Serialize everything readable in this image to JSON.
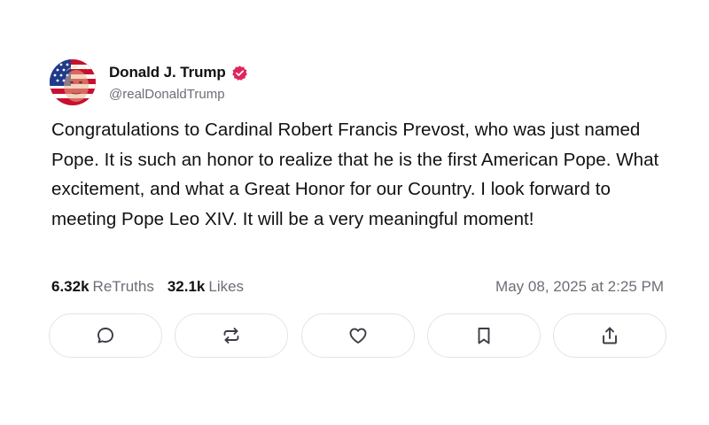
{
  "author": {
    "display_name": "Donald J. Trump",
    "handle": "@realDonaldTrump",
    "verified": true,
    "verified_color": "#e0245e"
  },
  "post": {
    "text": "Congratulations to Cardinal Robert Francis Prevost, who was just named Pope. It is such an honor to realize that he is the first American Pope. What excitement, and what a Great Honor for our Country. I look forward to meeting Pope Leo XIV. It will be a very meaningful moment!",
    "retruths_count": "6.32k",
    "retruths_label": "ReTruths",
    "likes_count": "32.1k",
    "likes_label": "Likes",
    "timestamp": "May 08, 2025 at 2:25 PM"
  },
  "actions": [
    {
      "name": "reply",
      "icon": "comment-icon"
    },
    {
      "name": "retruth",
      "icon": "repost-icon"
    },
    {
      "name": "like",
      "icon": "heart-icon"
    },
    {
      "name": "bookmark",
      "icon": "bookmark-icon"
    },
    {
      "name": "share",
      "icon": "share-icon"
    }
  ]
}
